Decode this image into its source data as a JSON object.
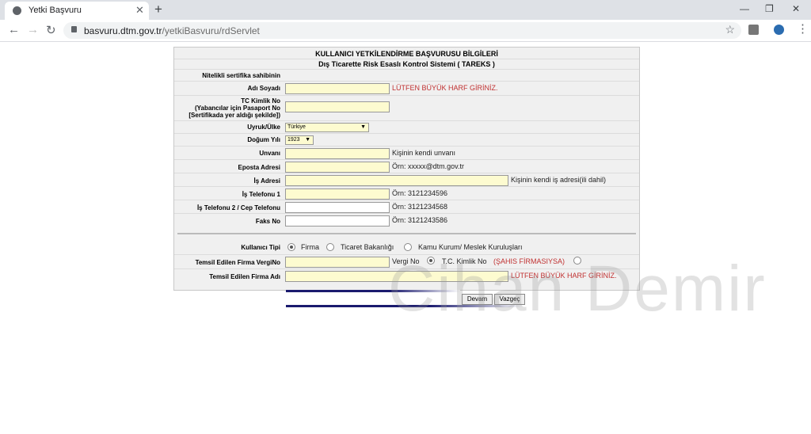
{
  "browser": {
    "tab_title": "Yetki Başvuru",
    "new_tab": "+",
    "close": "✕",
    "url_domain": "basvuru.dtm.gov.tr",
    "url_path": "/yetkiBasvuru/rdServlet",
    "win_min": "—",
    "win_restore": "❐",
    "win_close": "✕"
  },
  "form": {
    "title": "KULLANICI YETKİLENDİRME BAŞVURUSU BİLGİLERİ",
    "subtitle": "Dış Ticarette Risk Esaslı Kontrol Sistemi ( TAREKS )",
    "section_label": "Nitelikli sertifika sahibinin",
    "ad_soyad_label": "Adı Soyadı",
    "ad_soyad_note": "LÜTFEN BÜYÜK HARF GİRİNİZ.",
    "tc_label_1": "TC Kimlik No",
    "tc_label_2": "(Yabancılar için Pasaport No",
    "tc_label_3": "[Sertifikada yer aldığı şekilde])",
    "uyruk_label": "Uyruk/Ülke",
    "uyruk_value": "Türkiye",
    "dogum_label": "Doğum Yılı",
    "dogum_value": "1923",
    "unvan_label": "Unvanı",
    "unvan_note": "Kişinin kendi unvanı",
    "eposta_label": "Eposta Adresi",
    "eposta_note": "Örn: xxxxx@dtm.gov.tr",
    "is_adresi_label": "İş Adresi",
    "is_adresi_note": "Kişinin kendi iş adresi(ili dahil)",
    "is_tel1_label": "İş Telefonu 1",
    "is_tel1_note": "Örn: 3121234596",
    "is_tel2_label": "İş Telefonu 2 / Cep Telefonu",
    "is_tel2_note": "Örn: 3121234568",
    "faks_label": "Faks No",
    "faks_note": "Örn: 3121243586",
    "kullanici_tipi_label": "Kullanıcı Tipi",
    "tip_options": [
      "Firma",
      "Ticaret Bakanlığı",
      "Kamu Kurum/ Meslek Kuruluşları"
    ],
    "vergi_label": "Temsil Edilen Firma VergiNo",
    "vergi_opt1": "Vergi No",
    "vergi_opt2": "T.C. Kimlik No",
    "vergi_opt2_red": "(ŞAHIS FİRMASIYSA)",
    "firma_adi_label": "Temsil Edilen Firma Adı",
    "firma_adi_note": "LÜTFEN BÜYÜK HARF GİRİNİZ.",
    "devam": "Devam",
    "vazgec": "Vazgeç"
  },
  "watermark": "Cihan Demir",
  "colors": {
    "input_bg": "#fdfbd0",
    "red_note": "#c03030",
    "line_blue": "#1a1a6e"
  }
}
